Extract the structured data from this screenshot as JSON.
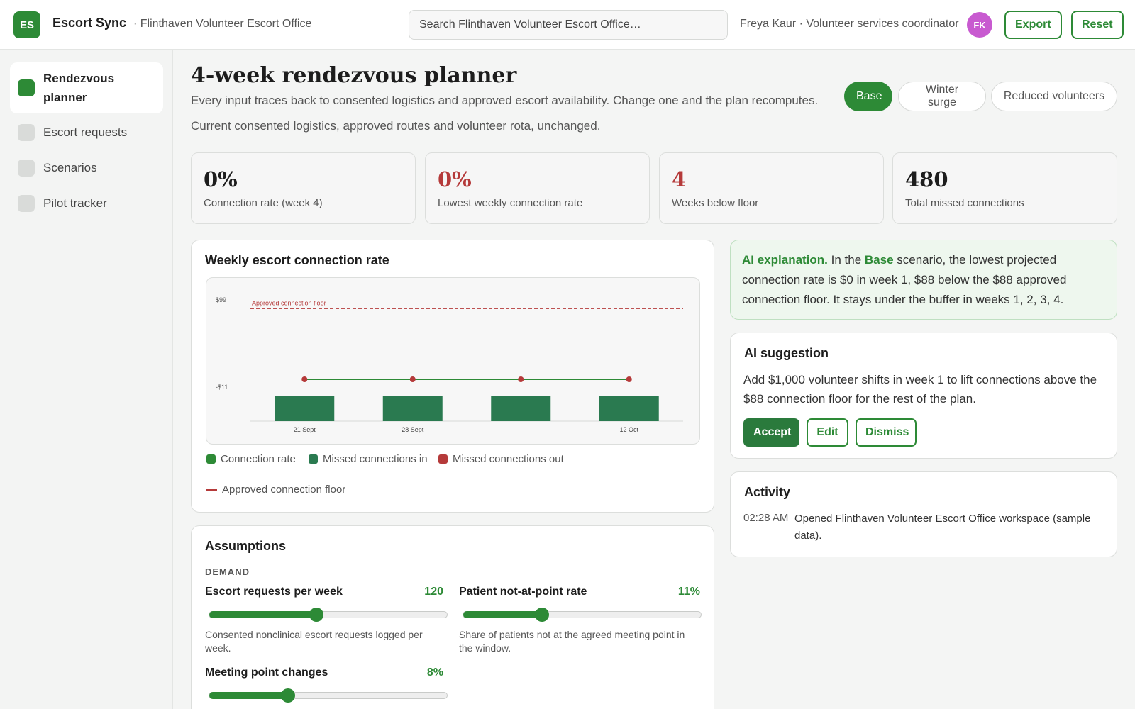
{
  "app": {
    "logo": "ES",
    "name": "Escort Sync",
    "org": "· Flinthaven Volunteer Escort Office",
    "search_placeholder": "Search Flinthaven Volunteer Escort Office…",
    "user": "Freya Kaur · Volunteer services coordinator",
    "avatar_initials": "FK",
    "export_label": "Export",
    "reset_label": "Reset"
  },
  "sidebar": {
    "items": [
      {
        "label": "Rendezvous planner",
        "active": true
      },
      {
        "label": "Escort requests"
      },
      {
        "label": "Scenarios"
      },
      {
        "label": "Pilot tracker"
      }
    ]
  },
  "header": {
    "title": "4-week rendezvous planner",
    "subtitle": "Every input traces back to consented logistics and approved escort availability. Change one and the plan recomputes.",
    "scenario_desc": "Current consented logistics, approved routes and volunteer rota, unchanged.",
    "scenarios": [
      "Base",
      "Winter surge",
      "Reduced volunteers"
    ],
    "active_scenario": "Base"
  },
  "kpis": [
    {
      "value": "0%",
      "label": "Connection rate (week 4)"
    },
    {
      "value": "0%",
      "label": "Lowest weekly connection rate",
      "color": "#b53a3a"
    },
    {
      "value": "4",
      "label": "Weeks below floor",
      "color": "#b53a3a"
    },
    {
      "value": "480",
      "label": "Total missed connections"
    }
  ],
  "chart": {
    "title": "Weekly escort connection rate",
    "legend": [
      "Connection rate",
      "Missed connections in",
      "Missed connections out",
      "Approved connection floor"
    ],
    "colors": {
      "rate": "#2d8a36",
      "in": "#2a7a50",
      "out": "#b53a3a",
      "floor": "#b53a3a"
    }
  },
  "chart_data": {
    "type": "bar",
    "categories": [
      "21 Sept",
      "28 Sept",
      "",
      "12 Oct"
    ],
    "y_ticks": [
      "$99",
      "-$11"
    ],
    "ylim": [
      -11,
      99
    ],
    "series": [
      {
        "name": "Connection rate",
        "type": "line",
        "values": [
          0,
          0,
          0,
          0
        ]
      },
      {
        "name": "Missed connections in",
        "type": "bar",
        "values": [
          -11,
          -11,
          -11,
          -11
        ]
      }
    ],
    "reference_line": {
      "label": "Approved connection floor",
      "value": 88
    }
  },
  "ai_explanation": {
    "prefix": "AI explanation.",
    "text_1": " In the ",
    "scenario": "Base",
    "text_2": " scenario, the lowest projected connection rate is $0 in week 1, $88 below the $88 approved connection floor. It stays under the buffer in weeks 1, 2, 3, 4."
  },
  "ai_suggestion": {
    "title": "AI suggestion",
    "text": "Add $1,000 volunteer shifts in week 1 to lift connections above the $88 connection floor for the rest of the plan.",
    "accept": "Accept",
    "edit": "Edit",
    "dismiss": "Dismiss"
  },
  "activity": {
    "title": "Activity",
    "entries": [
      {
        "time": "02:28 AM",
        "text": "Opened Flinthaven Volunteer Escort Office workspace (sample data)."
      }
    ]
  },
  "assumptions": {
    "title": "Assumptions",
    "section": "DEMAND",
    "sliders": [
      {
        "name": "Escort requests per week",
        "value": "120",
        "level": 0.45,
        "help": "Consented nonclinical escort requests logged per week."
      },
      {
        "name": "Patient not-at-point rate",
        "value": "11%",
        "level": 0.33,
        "help": "Share of patients not at the agreed meeting point in the window."
      },
      {
        "name": "Meeting point changes",
        "value": "8%",
        "level": 0.33,
        "help": ""
      }
    ]
  }
}
